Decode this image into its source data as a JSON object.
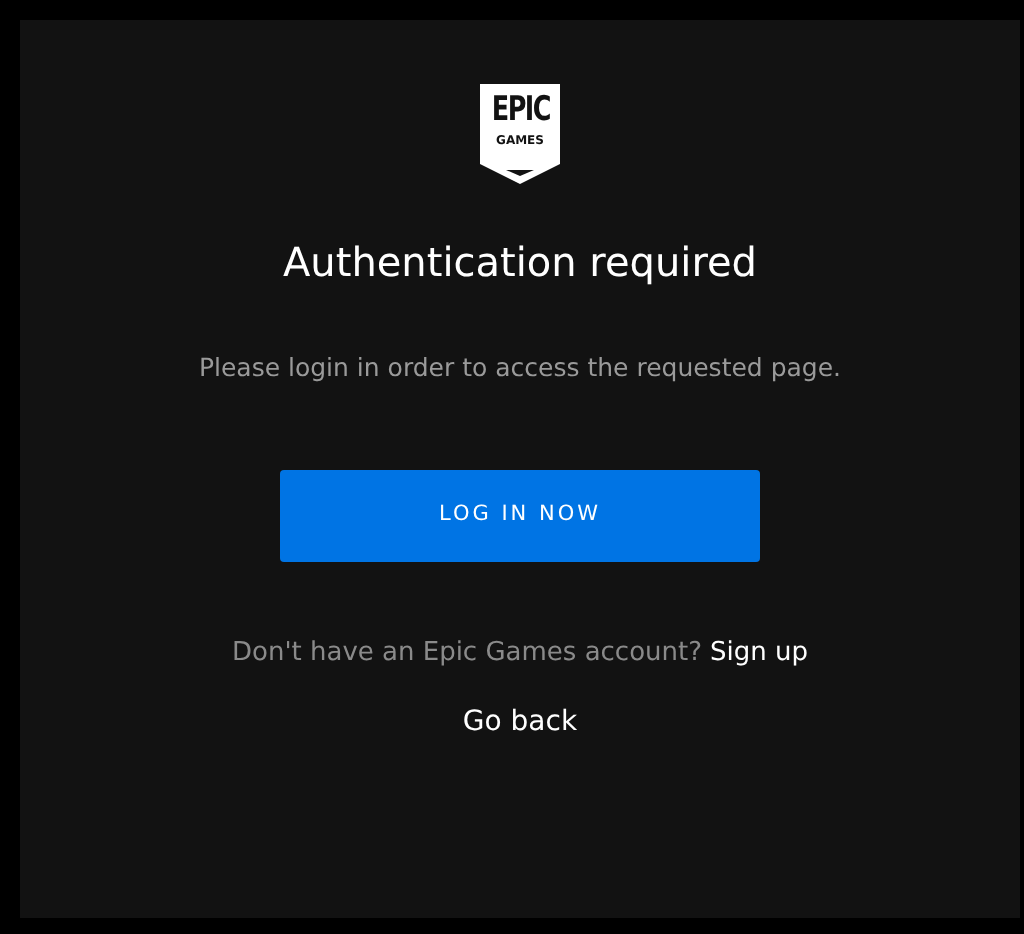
{
  "logo": {
    "line_1": "EPIC",
    "line_2": "GAMES"
  },
  "title": "Authentication required",
  "message": "Please login in order to access the requested page.",
  "login_button": "LOG IN NOW",
  "signup_prompt": {
    "text": "Don't have an Epic Games account?",
    "link": "Sign up"
  },
  "back_link": "Go back"
}
